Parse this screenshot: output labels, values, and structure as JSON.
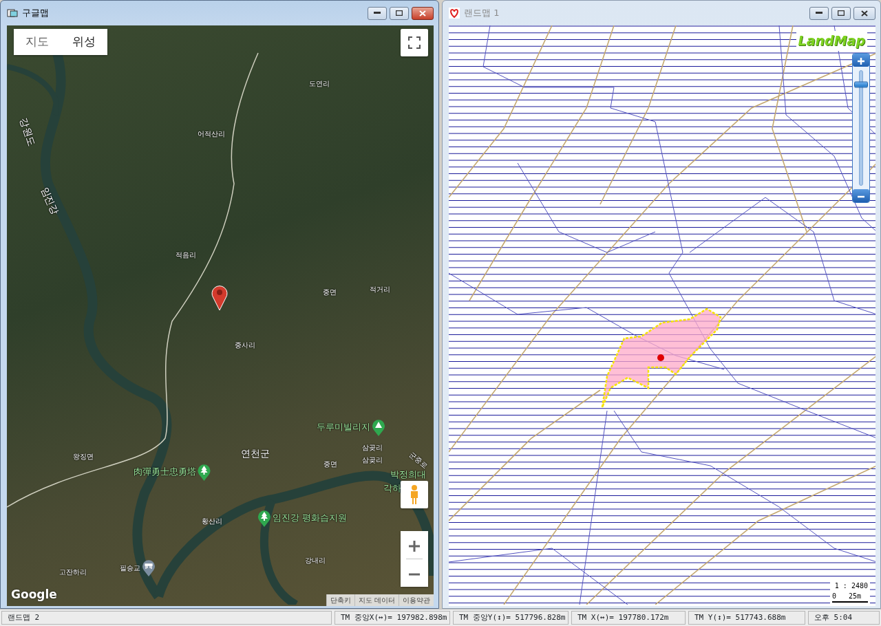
{
  "google_window": {
    "title": "구글맵",
    "active": true,
    "map_types": [
      {
        "label": "지도",
        "selected": false
      },
      {
        "label": "위성",
        "selected": true
      }
    ],
    "labels": [
      {
        "text": "도연리",
        "kind": "place"
      },
      {
        "text": "어적산리",
        "kind": "place"
      },
      {
        "text": "강원도",
        "kind": "province"
      },
      {
        "text": "임진강",
        "kind": "river"
      },
      {
        "text": "적음리",
        "kind": "place"
      },
      {
        "text": "중면",
        "kind": "place"
      },
      {
        "text": "적거리",
        "kind": "place"
      },
      {
        "text": "중사리",
        "kind": "place"
      },
      {
        "text": "두루미빌리지",
        "kind": "camp"
      },
      {
        "text": "삼곶리",
        "kind": "place"
      },
      {
        "text": "삼곶리",
        "kind": "place"
      },
      {
        "text": "군중로",
        "kind": "road"
      },
      {
        "text": "연천군",
        "kind": "region"
      },
      {
        "text": "肉彈勇士忠勇塔",
        "kind": "park"
      },
      {
        "text": "중면",
        "kind": "place"
      },
      {
        "text": "박정희대",
        "kind": "poi"
      },
      {
        "text": "각하",
        "kind": "poi"
      },
      {
        "text": "왕징면",
        "kind": "place"
      },
      {
        "text": "황산리",
        "kind": "place"
      },
      {
        "text": "임진강 평화습지원",
        "kind": "park"
      },
      {
        "text": "강내리",
        "kind": "place"
      },
      {
        "text": "필승교",
        "kind": "bridge"
      },
      {
        "text": "고잔하리",
        "kind": "place"
      }
    ],
    "logo": "Google",
    "footer_links": [
      "단축키",
      "지도 데이터",
      "이용약관"
    ]
  },
  "landmap_window": {
    "title": "랜드맵 1",
    "active": false,
    "logo": "LandMap",
    "zoom": {
      "level": 0.88
    },
    "scale": {
      "ratio": "1 : 2480",
      "start": "0",
      "end": "25m"
    }
  },
  "status_bar": [
    "랜드맵 2",
    "TM 중앙X(↔)= 197982.898m",
    "TM 중앙Y(↕)= 517796.828m",
    "TM X(↔)= 197780.172m",
    "TM Y(↕)= 517743.688m",
    "오후 5:04"
  ]
}
